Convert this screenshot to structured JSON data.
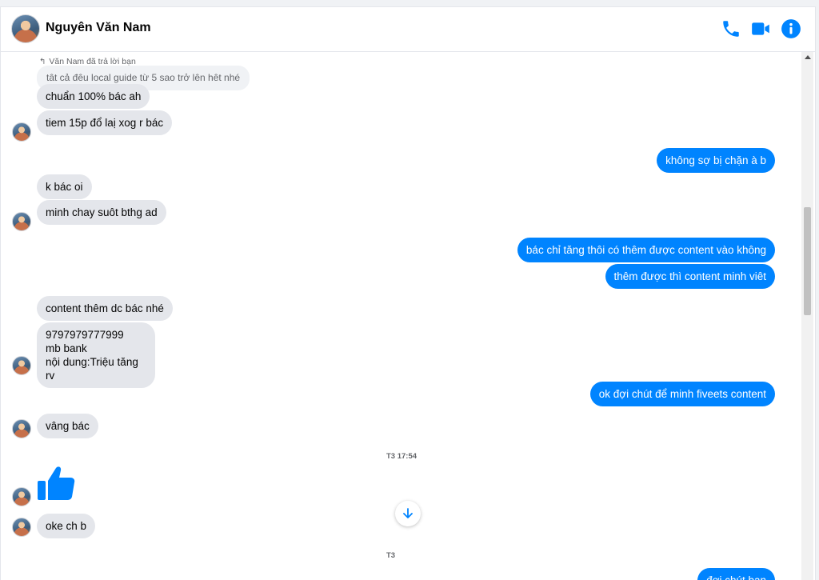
{
  "header": {
    "contact_name": "Nguyên Văn Nam",
    "icons": [
      "phone-icon",
      "video-camera-icon",
      "info-icon"
    ],
    "accent_color": "#0084ff"
  },
  "reply_note": "Văn Nam đã trả lời bạn",
  "quoted_text": "tât cả đêu local guide từ 5 sao trở lên hêt nhé",
  "messages": {
    "m1": "chuẩn 100% bác ah",
    "m2": "tiem 15p đổ laị xog r bác",
    "m3": "không sợ bị chặn à b",
    "m4": "k bác oi",
    "m5": "minh chay suôt bthg ad",
    "m6": "bác chỉ tăng thôi có thêm được content vào không",
    "m7": "thêm được thì content minh viêt",
    "m8": "content thêm dc bác nhé",
    "m9": [
      "9797979777999",
      "mb bank",
      "nội dung:Triệu tăng rv"
    ],
    "m10": "ok đợi chút để minh fiveets content",
    "m11": "vâng bác",
    "m12": "oke ch b",
    "m13": "đợi chút bạn"
  },
  "timestamps": {
    "t1": "T3 17:54",
    "t2": "T3"
  }
}
